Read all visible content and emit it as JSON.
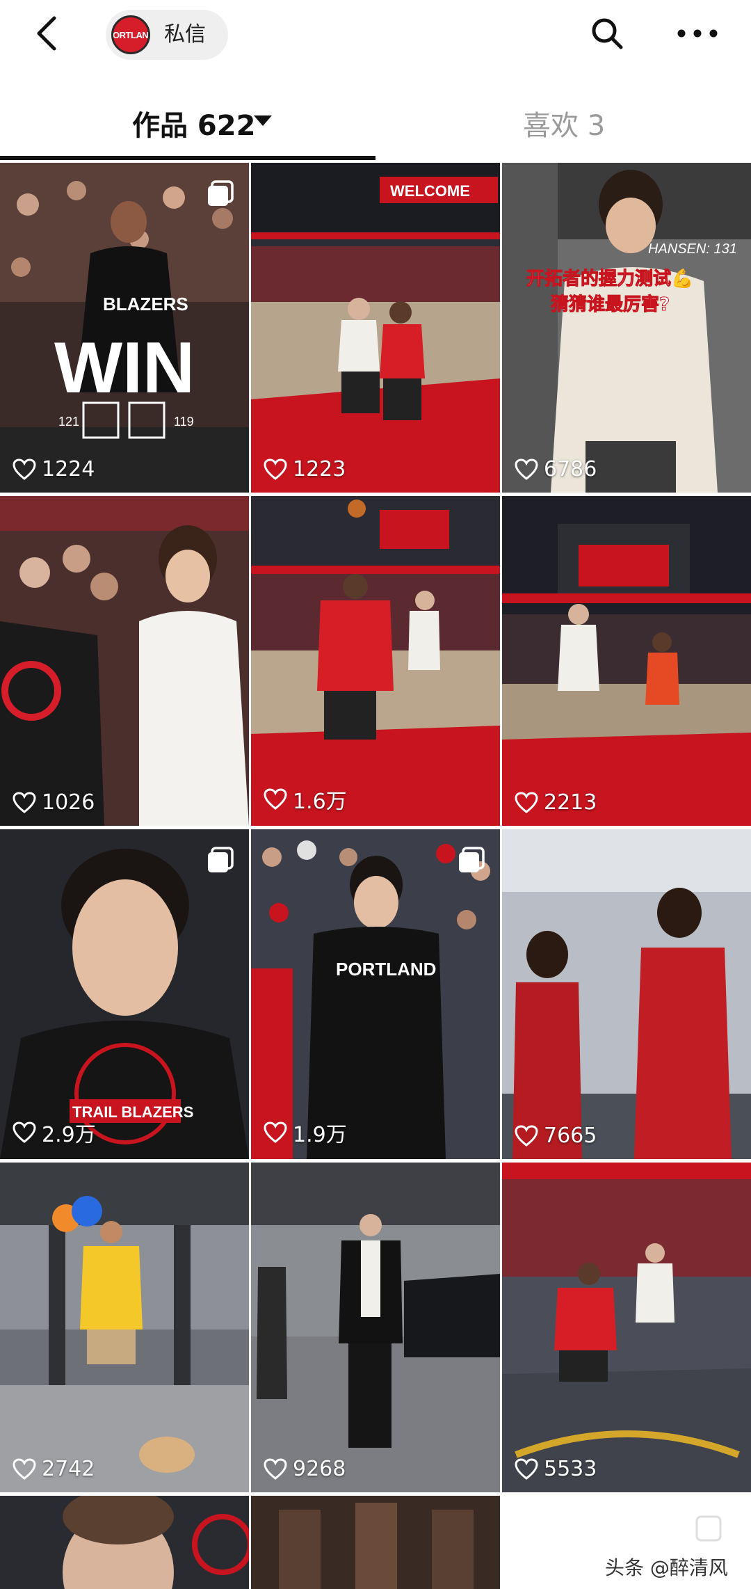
{
  "header": {
    "back_icon": "chevron-left-icon",
    "profile_logo_text": "PORTLAND",
    "message_label": "私信",
    "search_icon": "search-icon",
    "more_icon": "more-horizontal-icon"
  },
  "tabs": {
    "works_label": "作品 622",
    "likes_label": "喜欢 3"
  },
  "posts": [
    {
      "likes": "1224",
      "overlay_title": "WIN",
      "overlay_sub": "BLAZERS",
      "score_left": "121",
      "score_right": "119",
      "multi": true
    },
    {
      "likes": "1223",
      "overlay_title": "WELCOME",
      "multi": false
    },
    {
      "likes": "6786",
      "overlay_caption_1": "开拓者的握力测试💪",
      "overlay_caption_2": "猜猜谁最厉害?",
      "overlay_tag": "HANSEN: 131",
      "multi": false
    },
    {
      "likes": "1026",
      "multi": false
    },
    {
      "likes": "1.6万",
      "multi": false
    },
    {
      "likes": "2213",
      "multi": false
    },
    {
      "likes": "2.9万",
      "overlay_shirt": "TRAIL BLAZERS",
      "multi": true
    },
    {
      "likes": "1.9万",
      "overlay_shirt": "PORTLAND",
      "multi": true
    },
    {
      "likes": "7665",
      "multi": false
    },
    {
      "likes": "2742",
      "multi": false
    },
    {
      "likes": "9268",
      "multi": false
    },
    {
      "likes": "5533",
      "multi": false
    }
  ],
  "watermark": "头条 @醉清风",
  "colors": {
    "blazers_red": "#d61e2b",
    "court_red": "#c8141e",
    "tab_active": "#111111",
    "tab_inactive": "#9a9a9a"
  }
}
